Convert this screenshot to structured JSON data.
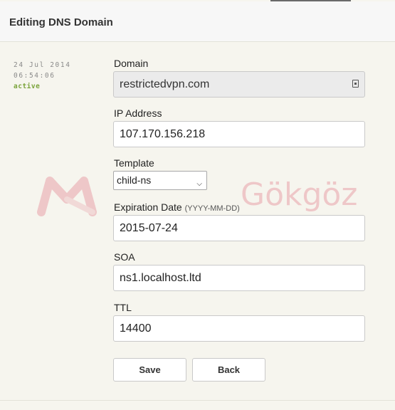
{
  "header": {
    "title": "Editing DNS Domain"
  },
  "meta": {
    "date": "24 Jul 2014",
    "time": "06:54:06",
    "status": "active"
  },
  "watermark": {
    "text": "Gökgöz"
  },
  "form": {
    "domain": {
      "label": "Domain",
      "value": "restrictedvpn.com"
    },
    "ip_address": {
      "label": "IP Address",
      "value": "107.170.156.218"
    },
    "template": {
      "label": "Template",
      "selected": "child-ns"
    },
    "expiration_date": {
      "label": "Expiration Date",
      "hint": "(YYYY-MM-DD)",
      "value": "2015-07-24"
    },
    "soa": {
      "label": "SOA",
      "value": "ns1.localhost.ltd"
    },
    "ttl": {
      "label": "TTL",
      "value": "14400"
    }
  },
  "buttons": {
    "save": "Save",
    "back": "Back"
  },
  "icons": {
    "domain_lock": "lock-icon",
    "select_arrow": "chevron-down-icon",
    "watermark_logo": "logo-icon"
  },
  "colors": {
    "status_active": "#7aa33a",
    "watermark": "#e06a7a"
  }
}
